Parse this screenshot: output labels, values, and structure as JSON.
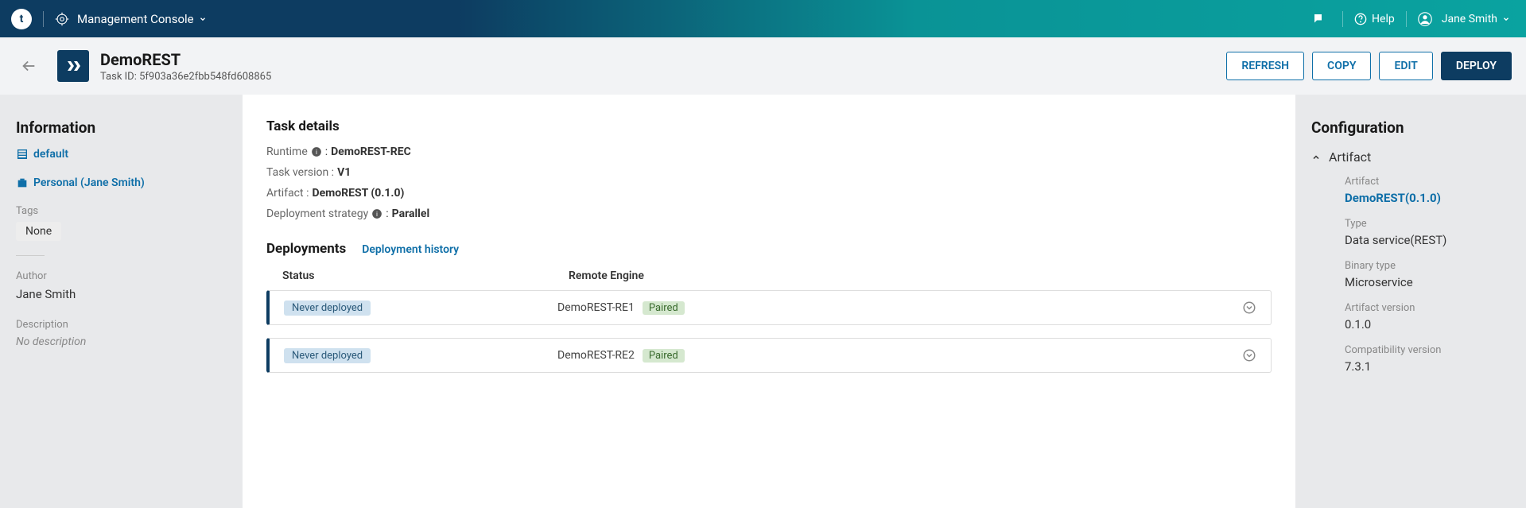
{
  "topnav": {
    "logo_letter": "t",
    "console_label": "Management Console",
    "help_label": "Help",
    "user_name": "Jane Smith"
  },
  "header": {
    "title": "DemoREST",
    "taskid_prefix": "Task ID: ",
    "taskid": "5f903a36e2fbb548fd608865",
    "refresh": "REFRESH",
    "copy": "COPY",
    "edit": "EDIT",
    "deploy": "DEPLOY"
  },
  "left": {
    "heading": "Information",
    "default_label": "default",
    "personal_label": "Personal (Jane Smith)",
    "tags_label": "Tags",
    "tag_value": "None",
    "author_label": "Author",
    "author_value": "Jane Smith",
    "desc_label": "Description",
    "desc_value": "No description"
  },
  "mid": {
    "details_heading": "Task details",
    "runtime_label": "Runtime",
    "runtime_value": "DemoREST-REC",
    "version_label": "Task version :",
    "version_value": "V1",
    "artifact_label": "Artifact :",
    "artifact_value": "DemoREST (0.1.0)",
    "strategy_label": "Deployment strategy",
    "strategy_value": "Parallel",
    "deployments_heading": "Deployments",
    "history_link": "Deployment history",
    "th_status": "Status",
    "th_engine": "Remote Engine",
    "rows": [
      {
        "status": "Never deployed",
        "engine": "DemoREST-RE1",
        "pair": "Paired"
      },
      {
        "status": "Never deployed",
        "engine": "DemoREST-RE2",
        "pair": "Paired"
      }
    ]
  },
  "right": {
    "heading": "Configuration",
    "accordion_label": "Artifact",
    "artifact_label": "Artifact",
    "artifact_value": "DemoREST(0.1.0)",
    "type_label": "Type",
    "type_value": "Data service(REST)",
    "binary_label": "Binary type",
    "binary_value": "Microservice",
    "artver_label": "Artifact version",
    "artver_value": "0.1.0",
    "compat_label": "Compatibility version",
    "compat_value": "7.3.1"
  }
}
